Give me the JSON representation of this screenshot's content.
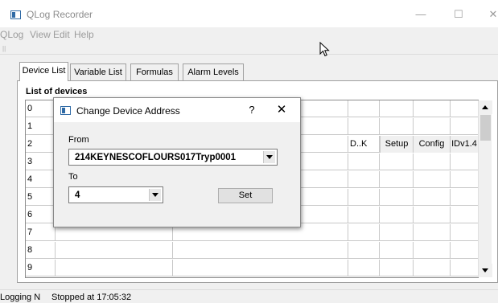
{
  "window": {
    "title": "QLog Recorder",
    "minimize": "—",
    "maximize": "☐",
    "close": "✕"
  },
  "menu": {
    "items": [
      "QLog",
      "View",
      "Edit",
      "Help"
    ]
  },
  "toolbar": {
    "grip": "||"
  },
  "tabs": [
    {
      "label": "Device List",
      "active": true
    },
    {
      "label": "Variable List",
      "active": false
    },
    {
      "label": "Formulas",
      "active": false
    },
    {
      "label": "Alarm Levels",
      "active": false
    }
  ],
  "device_list": {
    "group_label": "List of devices",
    "row_numbers": [
      "0",
      "1",
      "2",
      "3",
      "4",
      "5",
      "6",
      "7",
      "8",
      "9"
    ],
    "row2": {
      "type": "D..K",
      "setup": "Setup",
      "config": "Config",
      "id": "IDv1.4"
    }
  },
  "dialog": {
    "title": "Change Device Address",
    "help": "?",
    "close": "✕",
    "from_label": "From",
    "from_value": "214KEYNESCOFLOURS017Tryp0001",
    "to_label": "To",
    "to_value": "4",
    "set_label": "Set"
  },
  "status": {
    "logging": "Logging N",
    "stopped": "Stopped at 17:05:32"
  }
}
